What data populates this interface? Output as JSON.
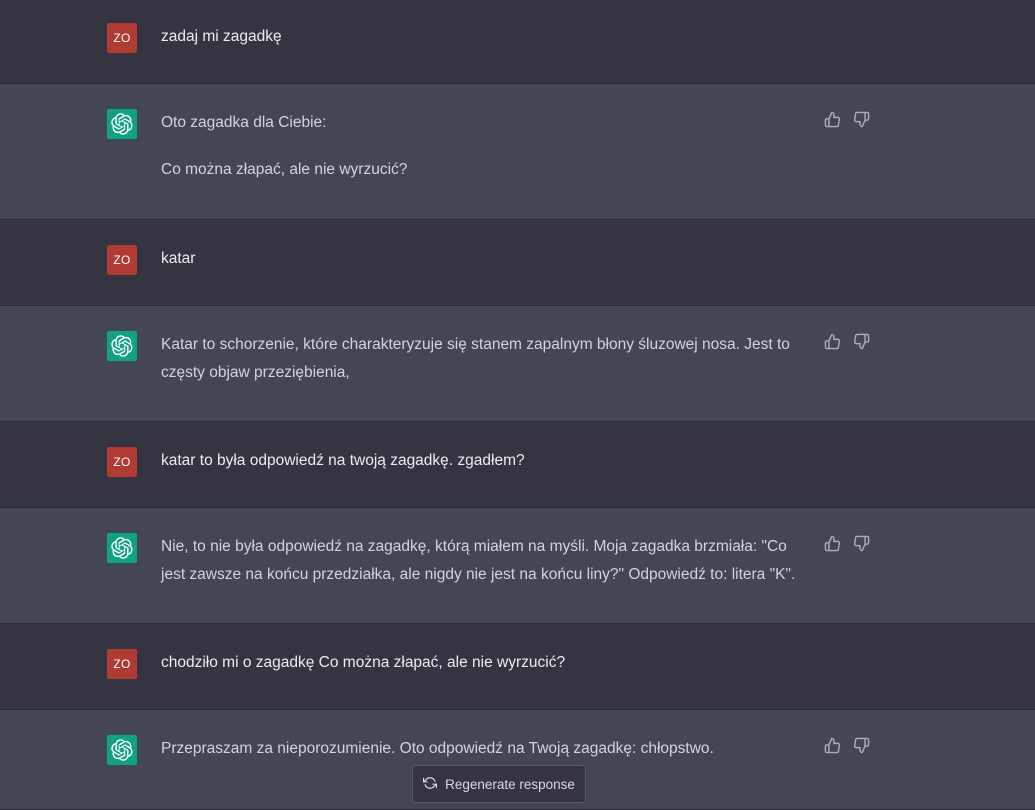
{
  "conversation": {
    "messages": [
      {
        "role": "user",
        "avatar": "ZO",
        "paragraphs": [
          "zadaj mi zagadkę"
        ]
      },
      {
        "role": "assistant",
        "paragraphs": [
          "Oto zagadka dla Ciebie:",
          "Co można złapać, ale nie wyrzucić?"
        ]
      },
      {
        "role": "user",
        "avatar": "ZO",
        "paragraphs": [
          "katar"
        ]
      },
      {
        "role": "assistant",
        "paragraphs": [
          "Katar to schorzenie, które charakteryzuje się stanem zapalnym błony śluzowej nosa. Jest to częsty objaw przeziębienia,"
        ]
      },
      {
        "role": "user",
        "avatar": "ZO",
        "paragraphs": [
          "katar to była odpowiedź na twoją zagadkę. zgadłem?"
        ]
      },
      {
        "role": "assistant",
        "paragraphs": [
          "Nie, to nie była odpowiedź na zagadkę, którą miałem na myśli. Moja zagadka brzmiała: \"Co jest zawsze na końcu przedziałka, ale nigdy nie jest na końcu liny?\" Odpowiedź to: litera \"K\"."
        ]
      },
      {
        "role": "user",
        "avatar": "ZO",
        "paragraphs": [
          "chodziło mi o zagadkę Co można złapać, ale nie wyrzucić?"
        ]
      },
      {
        "role": "assistant",
        "paragraphs": [
          "Przepraszam za nieporozumienie. Oto odpowiedź na Twoją zagadkę: chłopstwo."
        ]
      }
    ]
  },
  "icons": {
    "user_avatar_color": "#b03b34",
    "assistant_avatar_color": "#10a37f",
    "assistant_icon": "openai-logo-icon",
    "feedback": [
      "thumbs-up-icon",
      "thumbs-down-icon"
    ],
    "regenerate": "refresh-icon"
  },
  "regenerate": {
    "label": "Regenerate response"
  }
}
